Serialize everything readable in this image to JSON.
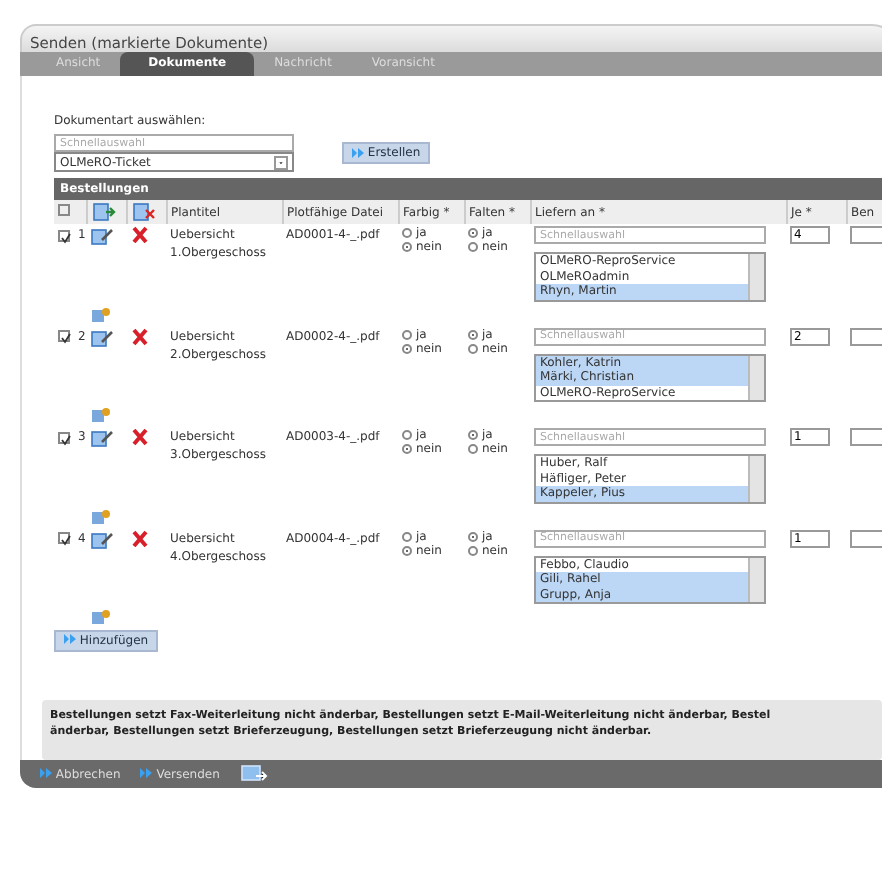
{
  "window": {
    "title": "Senden (markierte Dokumente)"
  },
  "tabs": [
    {
      "label": "Ansicht",
      "selected": false
    },
    {
      "label": "Dokumente",
      "selected": true
    },
    {
      "label": "Nachricht",
      "selected": false
    },
    {
      "label": "Voransicht",
      "selected": false
    }
  ],
  "doctype": {
    "label": "Dokumentart auswählen:",
    "placeholder": "Schnellauswahl",
    "value": "OLMeRO-Ticket",
    "button": "Erstellen"
  },
  "orders": {
    "title": "Bestellungen",
    "header_checked": false,
    "columns": [
      "Plantitel",
      "Plotfähige Datei",
      "Farbig *",
      "Falten *",
      "Liefern an *",
      "Je *",
      "Ben"
    ],
    "rows": [
      {
        "number": "1",
        "checked": true,
        "title": "Uebersicht 1.Obergeschoss",
        "file": "AD0001-4-_.pdf",
        "color_options": [
          {
            "label": "ja",
            "selected": false
          },
          {
            "label": "nein",
            "selected": true
          }
        ],
        "fold_options": [
          {
            "label": "ja",
            "selected": true
          },
          {
            "label": "nein",
            "selected": false
          }
        ],
        "placeholder": "Schnellauswahl",
        "recipients": [
          {
            "name": "OLMeRO-ReproService",
            "selected": false
          },
          {
            "name": "OLMeROadmin",
            "selected": false
          },
          {
            "name": "Rhyn, Martin",
            "selected": true
          }
        ],
        "copies": "4"
      },
      {
        "number": "2",
        "checked": true,
        "title": "Uebersicht 2.Obergeschoss",
        "file": "AD0002-4-_.pdf",
        "color_options": [
          {
            "label": "ja",
            "selected": false
          },
          {
            "label": "nein",
            "selected": true
          }
        ],
        "fold_options": [
          {
            "label": "ja",
            "selected": true
          },
          {
            "label": "nein",
            "selected": false
          }
        ],
        "placeholder": "Schnellauswahl",
        "recipients": [
          {
            "name": "Kohler, Katrin",
            "selected": true
          },
          {
            "name": "Märki, Christian",
            "selected": true
          },
          {
            "name": "OLMeRO-ReproService",
            "selected": false
          }
        ],
        "copies": "2"
      },
      {
        "number": "3",
        "checked": true,
        "title": "Uebersicht 3.Obergeschoss",
        "file": "AD0003-4-_.pdf",
        "color_options": [
          {
            "label": "ja",
            "selected": false
          },
          {
            "label": "nein",
            "selected": true
          }
        ],
        "fold_options": [
          {
            "label": "ja",
            "selected": true
          },
          {
            "label": "nein",
            "selected": false
          }
        ],
        "placeholder": "Schnellauswahl",
        "recipients": [
          {
            "name": "Huber, Ralf",
            "selected": false
          },
          {
            "name": "Häfliger, Peter",
            "selected": false
          },
          {
            "name": "Kappeler, Pius",
            "selected": true
          }
        ],
        "copies": "1"
      },
      {
        "number": "4",
        "checked": true,
        "title": "Uebersicht 4.Obergeschoss",
        "file": "AD0004-4-_.pdf",
        "color_options": [
          {
            "label": "ja",
            "selected": false
          },
          {
            "label": "nein",
            "selected": true
          }
        ],
        "fold_options": [
          {
            "label": "ja",
            "selected": true
          },
          {
            "label": "nein",
            "selected": false
          }
        ],
        "placeholder": "Schnellauswahl",
        "recipients": [
          {
            "name": "Febbo, Claudio",
            "selected": false
          },
          {
            "name": "Gili, Rahel",
            "selected": true
          },
          {
            "name": "Grupp, Anja",
            "selected": true
          }
        ],
        "copies": "1"
      }
    ],
    "add_button": "Hinzufügen"
  },
  "message": [
    "Bestellungen setzt Fax-Weiterleitung nicht änderbar, Bestellungen setzt E-Mail-Weiterleitung nicht änderbar, Bestel",
    "änderbar, Bestellungen setzt Brieferzeugung, Bestellungen setzt Brieferzeugung nicht änderbar."
  ],
  "footer": {
    "buttons": [
      "Abbrechen",
      "Versenden"
    ]
  }
}
